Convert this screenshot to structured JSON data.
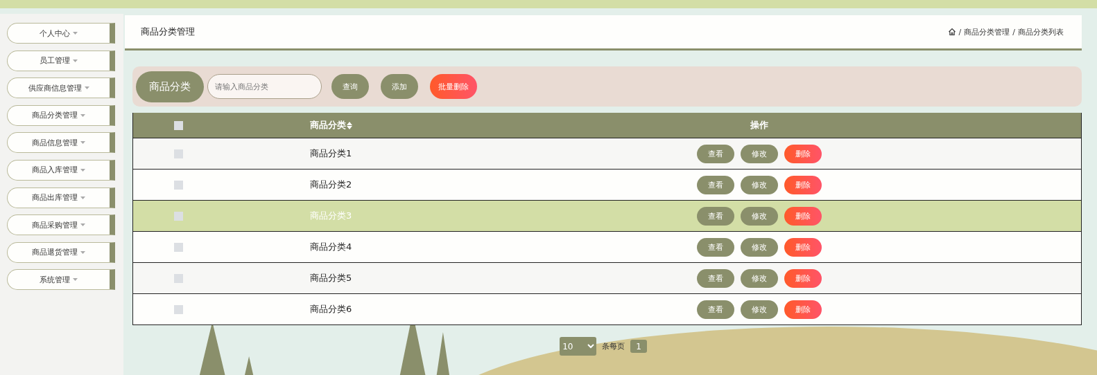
{
  "sidebar": {
    "items": [
      {
        "label": "个人中心"
      },
      {
        "label": "员工管理"
      },
      {
        "label": "供应商信息管理"
      },
      {
        "label": "商品分类管理"
      },
      {
        "label": "商品信息管理"
      },
      {
        "label": "商品入库管理"
      },
      {
        "label": "商品出库管理"
      },
      {
        "label": "商品采购管理"
      },
      {
        "label": "商品退货管理"
      },
      {
        "label": "系统管理"
      }
    ]
  },
  "header": {
    "title": "商品分类管理",
    "breadcrumb": {
      "separator": "/",
      "items": [
        "商品分类管理",
        "商品分类列表"
      ]
    }
  },
  "search": {
    "label": "商品分类",
    "placeholder": "请输入商品分类",
    "buttons": [
      {
        "label": "查询",
        "kind": "plain"
      },
      {
        "label": "添加",
        "kind": "plain"
      },
      {
        "label": "批量删除",
        "kind": "danger"
      }
    ]
  },
  "table": {
    "header_checked": false,
    "columns": [
      "商品分类",
      "操作"
    ],
    "rows": [
      {
        "name": "商品分类1",
        "checked": false,
        "highlighted": false,
        "actions": [
          {
            "label": "查看",
            "kind": "plain"
          },
          {
            "label": "修改",
            "kind": "plain"
          },
          {
            "label": "删除",
            "kind": "danger"
          }
        ]
      },
      {
        "name": "商品分类2",
        "checked": false,
        "highlighted": false,
        "actions": [
          {
            "label": "查看",
            "kind": "plain"
          },
          {
            "label": "修改",
            "kind": "plain"
          },
          {
            "label": "删除",
            "kind": "danger"
          }
        ]
      },
      {
        "name": "商品分类3",
        "checked": false,
        "highlighted": true,
        "actions": [
          {
            "label": "查看",
            "kind": "plain"
          },
          {
            "label": "修改",
            "kind": "plain"
          },
          {
            "label": "删除",
            "kind": "danger"
          }
        ]
      },
      {
        "name": "商品分类4",
        "checked": false,
        "highlighted": false,
        "actions": [
          {
            "label": "查看",
            "kind": "plain"
          },
          {
            "label": "修改",
            "kind": "plain"
          },
          {
            "label": "删除",
            "kind": "danger"
          }
        ]
      },
      {
        "name": "商品分类5",
        "checked": false,
        "highlighted": false,
        "actions": [
          {
            "label": "查看",
            "kind": "plain"
          },
          {
            "label": "修改",
            "kind": "plain"
          },
          {
            "label": "删除",
            "kind": "danger"
          }
        ]
      },
      {
        "name": "商品分类6",
        "checked": false,
        "highlighted": false,
        "actions": [
          {
            "label": "查看",
            "kind": "plain"
          },
          {
            "label": "修改",
            "kind": "plain"
          },
          {
            "label": "删除",
            "kind": "danger"
          }
        ]
      }
    ]
  },
  "pagination": {
    "page_size": "10",
    "page_size_label": "条每页",
    "pages": [
      {
        "label": "1",
        "selected": true
      }
    ]
  }
}
